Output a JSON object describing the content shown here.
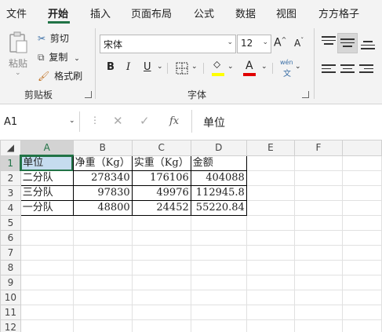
{
  "tabs": [
    "文件",
    "开始",
    "插入",
    "页面布局",
    "公式",
    "数据",
    "视图",
    "方方格子"
  ],
  "clipboard": {
    "paste": "粘贴",
    "cut": "剪切",
    "copy": "复制",
    "format_painter": "格式刷",
    "group_label": "剪贴板"
  },
  "font": {
    "name": "宋体",
    "size": "12",
    "group_label": "字体",
    "bold": "B",
    "italic": "I",
    "underline": "U",
    "grow": "A",
    "shrink": "A",
    "phonetic_top": "wén",
    "phonetic_bottom": "文",
    "fill_color": "#ffff00",
    "font_color": "#e00000"
  },
  "namebox": "A1",
  "fx": "fx",
  "formula": "单位",
  "columns": [
    "A",
    "B",
    "C",
    "D",
    "E",
    "F"
  ],
  "rows": [
    [
      "单位",
      "净重（Kg）",
      "实重（Kg）",
      "金额",
      "",
      ""
    ],
    [
      "二分队",
      "278340",
      "176106",
      "404088",
      "",
      ""
    ],
    [
      "三分队",
      "97830",
      "49976",
      "112945.8",
      "",
      ""
    ],
    [
      "一分队",
      "48800",
      "24452",
      "55220.84",
      "",
      ""
    ],
    [
      "",
      "",
      "",
      "",
      "",
      ""
    ],
    [
      "",
      "",
      "",
      "",
      "",
      ""
    ],
    [
      "",
      "",
      "",
      "",
      "",
      ""
    ],
    [
      "",
      "",
      "",
      "",
      "",
      ""
    ],
    [
      "",
      "",
      "",
      "",
      "",
      ""
    ],
    [
      "",
      "",
      "",
      "",
      "",
      ""
    ],
    [
      "",
      "",
      "",
      "",
      "",
      ""
    ],
    [
      "",
      "",
      "",
      "",
      "",
      ""
    ]
  ],
  "row_numbers": [
    "1",
    "2",
    "3",
    "4",
    "5",
    "6",
    "7",
    "8",
    "9",
    "10",
    "11",
    "12"
  ],
  "accent": "#217346"
}
